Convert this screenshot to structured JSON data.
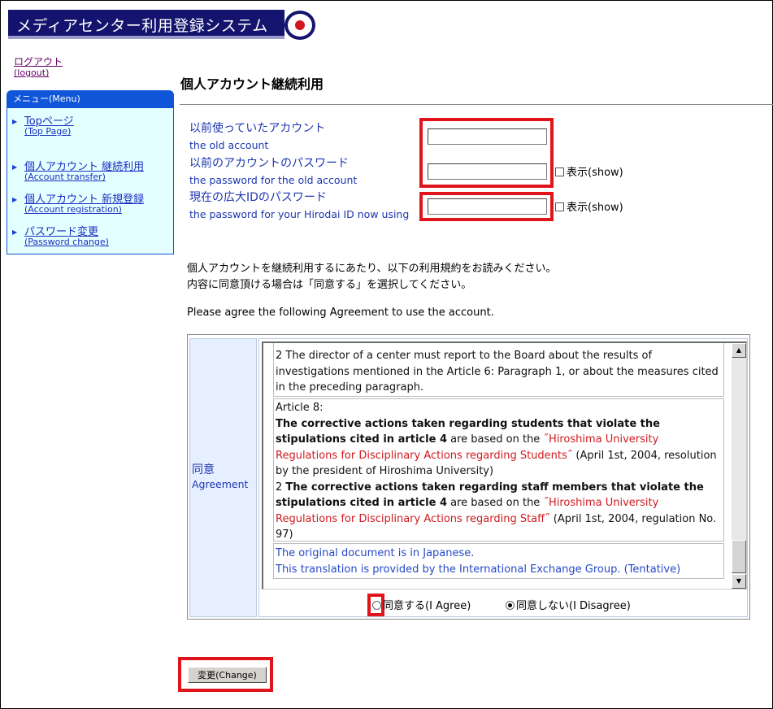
{
  "header": {
    "title": "メディアセンター利用登録システム"
  },
  "logout": {
    "jp": "ログアウト",
    "en": "(logout)"
  },
  "menu": {
    "title": "メニュー(Menu)",
    "items": [
      {
        "jp": "Topページ",
        "en": "(Top Page)"
      },
      {
        "jp": "個人アカウント 継続利用",
        "en": "(Account transfer)"
      },
      {
        "jp": "個人アカウント 新規登録",
        "en": "(Account registration)"
      },
      {
        "jp": "パスワード変更",
        "en": "(Password change)"
      }
    ]
  },
  "page": {
    "title": "個人アカウント継続利用"
  },
  "form": {
    "old_account": {
      "jp": "以前使っていたアカウント",
      "en": "the old account",
      "value": ""
    },
    "old_password": {
      "jp": "以前のアカウントのパスワード",
      "en": "the password for the old account",
      "value": "",
      "show_label": "表示(show)"
    },
    "hirodai_password": {
      "jp": "現在の広大IDのパスワード",
      "en": "the password for your Hirodai ID now using",
      "value": "",
      "show_label": "表示(show)"
    }
  },
  "instructions": {
    "line1": "個人アカウントを継続利用するにあたり、以下の利用規約をお読みください。",
    "line2": "内容に同意頂ける場合は「同意する」を選択してください。",
    "line3": "Please agree the following Agreement to use the account."
  },
  "agreement": {
    "label_jp": "同意",
    "label_en": "Agreement",
    "row1": "2 The director of a center must report to the Board about the results of investigations mentioned in the Article 6: Paragraph 1, or about the measures cited in the preceding paragraph.",
    "row2": {
      "heading": "Article 8:",
      "p1_bold": "The corrective actions taken regarding students that violate the stipulations cited in article 4",
      "p1_mid": " are based on the ",
      "p1_red": "˝Hiroshima University Regulations for Disciplinary Actions regarding Students˝",
      "p1_end": " (April 1st, 2004, resolution by the president of Hiroshima University)",
      "p2_num": "2 ",
      "p2_bold": "The corrective actions taken regarding staff members that violate the stipulations cited in article 4",
      "p2_mid": " are based on the ",
      "p2_red": "˝Hiroshima University Regulations for Disciplinary Actions regarding Staff˝",
      "p2_end": " (April 1st, 2004, regulation No. 97)"
    },
    "row3": {
      "line1": "The original document is in Japanese.",
      "line2": "This translation is provided by the International Exchange Group. (Tentative)"
    },
    "agree_label": "同意する(I Agree)",
    "disagree_label": "同意しない(I Disagree)",
    "selected": "disagree"
  },
  "buttons": {
    "change": "変更(Change)"
  },
  "colors": {
    "banner": "#14146e",
    "menu_header": "#0f56d8",
    "menu_bg": "#e4ffff",
    "highlight": "#e0151b",
    "label_blue": "#1c36b0"
  }
}
